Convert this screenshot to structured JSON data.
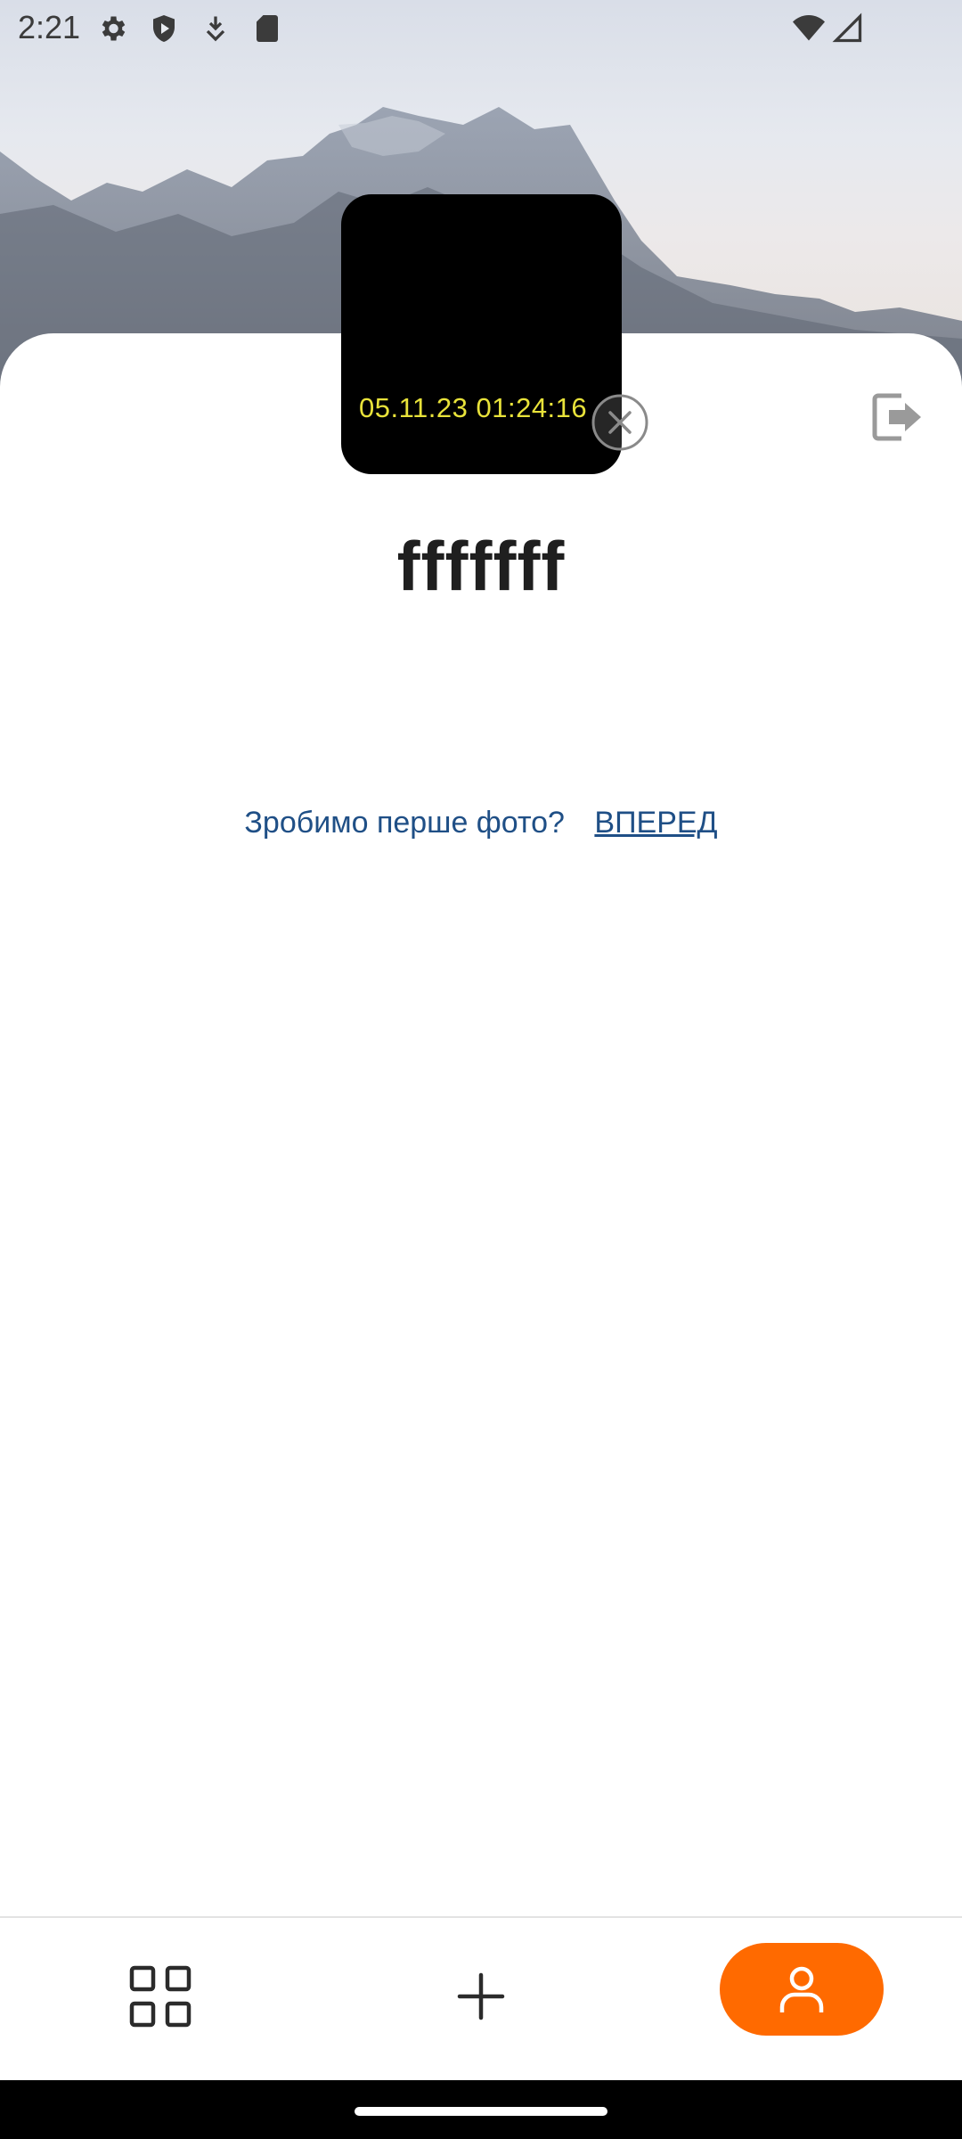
{
  "status_bar": {
    "time": "2:21",
    "icons": [
      "settings-icon",
      "shield-play-icon",
      "download-arrow-icon",
      "sd-card-icon",
      "wifi-icon",
      "signal-icon"
    ]
  },
  "header": {
    "photo_timestamp": "05.11.23 01:24:16",
    "username": "fffffff"
  },
  "main": {
    "prompt_text": "Зробимо перше фото?",
    "prompt_action": "ВПЕРЕД"
  },
  "bottom_nav": {
    "items": [
      "grid-icon",
      "add-icon",
      "profile-icon"
    ],
    "active": "profile-icon",
    "accent_color": "#ff6a00"
  }
}
